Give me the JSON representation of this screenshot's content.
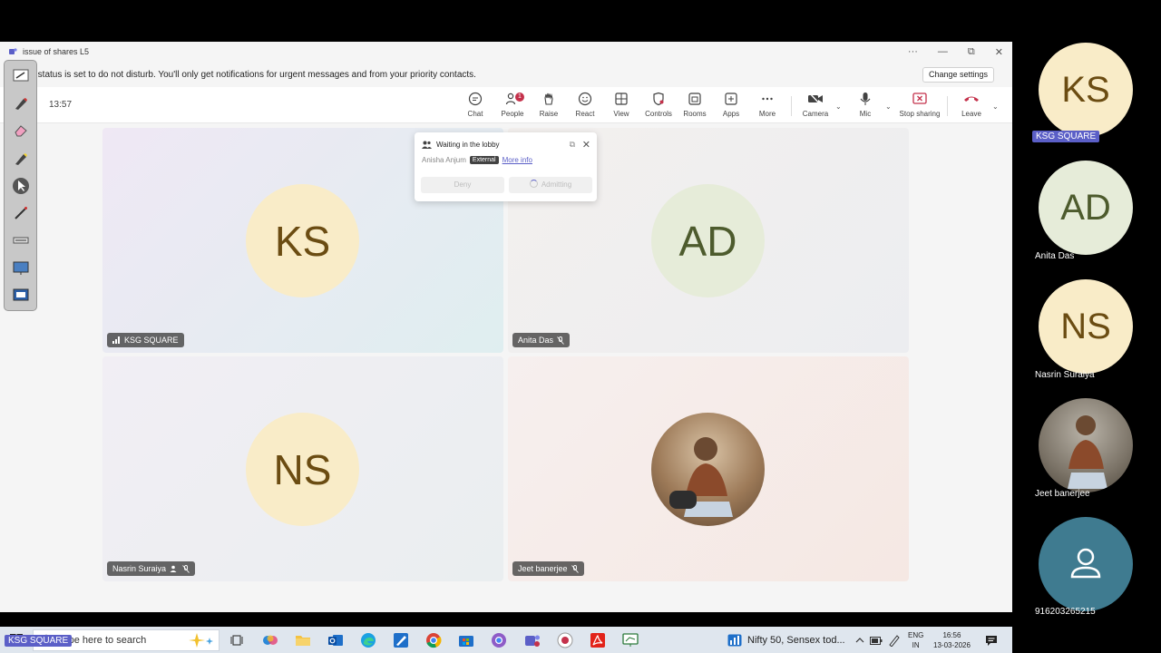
{
  "window": {
    "title": "issue of shares L5",
    "controls": [
      "···",
      "—",
      "⧉",
      "✕"
    ]
  },
  "notice": {
    "text": "ur status is set to do not disturb. You'll only get notifications for urgent messages and from your priority contacts.",
    "button": "Change settings"
  },
  "meeting": {
    "timer": "13:57",
    "toolbar": [
      {
        "label": "Chat",
        "icon": "chat-icon"
      },
      {
        "label": "People",
        "icon": "people-icon",
        "badge": "1"
      },
      {
        "label": "Raise",
        "icon": "hand-icon"
      },
      {
        "label": "React",
        "icon": "smile-icon"
      },
      {
        "label": "View",
        "icon": "grid-icon"
      },
      {
        "label": "Controls",
        "icon": "shield-icon"
      },
      {
        "label": "Rooms",
        "icon": "rooms-icon"
      },
      {
        "label": "Apps",
        "icon": "plus-icon"
      },
      {
        "label": "More",
        "icon": "ellipsis-icon"
      },
      {
        "label": "Camera",
        "icon": "camera-off-icon"
      },
      {
        "label": "Mic",
        "icon": "mic-icon"
      },
      {
        "label": "Stop sharing",
        "icon": "stop-share-icon"
      },
      {
        "label": "Leave",
        "icon": "phone-hangup-icon"
      }
    ]
  },
  "lobby": {
    "title": "Waiting in the lobby",
    "person": "Anisha Anjum",
    "tag": "External",
    "more": "More info",
    "deny": "Deny",
    "admit": "Admitting"
  },
  "tiles": [
    {
      "initials": "KS",
      "name": "KSG SQUARE",
      "bg": "#f9ecc8"
    },
    {
      "initials": "AD",
      "name": "Anita Das",
      "bg": "#e6ecd9"
    },
    {
      "initials": "NS",
      "name": "Nasrin Suraiya",
      "bg": "#f9ecc8"
    },
    {
      "initials": "",
      "name": "Jeet banerjee",
      "bg": "#b89a78"
    }
  ],
  "taskbar": {
    "search_placeholder": "Type here to search",
    "news": "Nifty 50, Sensex tod...",
    "lang1": "ENG",
    "lang2": "IN",
    "time": "16:56",
    "date": "13-03-2026"
  },
  "side": {
    "participants": [
      {
        "initials": "KS",
        "name": "KSG SQUARE"
      },
      {
        "initials": "AD",
        "name": "Anita Das"
      },
      {
        "initials": "NS",
        "name": "Nasrin Suraiya"
      },
      {
        "initials": "",
        "name": "Jeet  banerjee"
      },
      {
        "initials": "",
        "name": "916203265215"
      }
    ],
    "presenter_tag": "KSG SQUARE"
  },
  "colors": {
    "accent": "#5b5fc7",
    "danger": "#c4314b"
  }
}
